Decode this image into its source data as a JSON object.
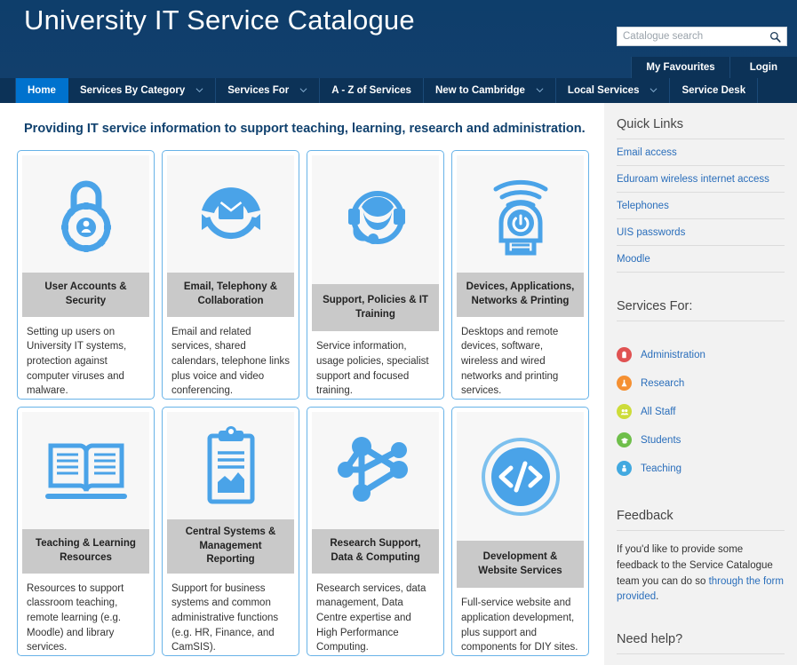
{
  "header": {
    "site_title": "University IT Service Catalogue",
    "search": {
      "placeholder": "Catalogue search",
      "value": "",
      "button_icon": "search-icon"
    },
    "account": {
      "favourites_label": "My Favourites",
      "login_label": "Login"
    },
    "colors": {
      "header_bg": "#10416e",
      "nav_bg": "#0c3257",
      "active_tab": "#0072ce"
    }
  },
  "nav": {
    "items": [
      {
        "label": "Home",
        "active": true,
        "caret": false
      },
      {
        "label": "Services By Category",
        "active": false,
        "caret": true
      },
      {
        "label": "Services For",
        "active": false,
        "caret": true
      },
      {
        "label": "A - Z of Services",
        "active": false,
        "caret": false
      },
      {
        "label": "New to Cambridge",
        "active": false,
        "caret": true
      },
      {
        "label": "Local Services",
        "active": false,
        "caret": true
      },
      {
        "label": "Service Desk",
        "active": false,
        "caret": false
      }
    ]
  },
  "main": {
    "intro": "Providing IT service information to support teaching, learning, research and administration.",
    "cards": [
      {
        "icon": "padlock-user-icon",
        "title": "User Accounts & Security",
        "desc": "Setting up users on University IT systems,  protection against computer viruses and malware."
      },
      {
        "icon": "email-collaboration-icon",
        "title": "Email, Telephony & Collaboration",
        "desc": "Email and related services, shared calendars, telephone links plus voice and video conferencing."
      },
      {
        "icon": "headset-support-icon",
        "title": "Support, Policies & IT Training",
        "desc": "Service information, usage policies, specialist support and focused training."
      },
      {
        "icon": "device-power-wireless-icon",
        "title": "Devices, Applications, Networks & Printing",
        "desc": "Desktops and remote devices, software, wireless and wired networks and printing services."
      },
      {
        "icon": "open-book-icon",
        "title": "Teaching & Learning Resources",
        "desc": "Resources to support classroom teaching, remote learning (e.g. Moodle) and library services."
      },
      {
        "icon": "clipboard-chart-icon",
        "title": "Central Systems & Management Reporting",
        "desc": "Support for business systems and common administrative functions (e.g. HR, Finance, and CamSIS)."
      },
      {
        "icon": "network-nodes-icon",
        "title": "Research Support, Data & Computing",
        "desc": "Research services, data management, Data Centre expertise and High Performance Computing."
      },
      {
        "icon": "code-brackets-icon",
        "title": "Development & Website Services",
        "desc": "Full-service website and application development, plus support and components for DIY sites."
      }
    ]
  },
  "sidebar": {
    "quick_links": {
      "heading": "Quick Links",
      "items": [
        {
          "label": "Email access"
        },
        {
          "label": "Eduroam wireless internet access"
        },
        {
          "label": "Telephones"
        },
        {
          "label": "UIS passwords"
        },
        {
          "label": "Moodle"
        }
      ]
    },
    "services_for": {
      "heading": "Services For:",
      "items": [
        {
          "label": "Administration",
          "color": "#e05252",
          "icon": "clipboard-icon"
        },
        {
          "label": "Research",
          "color": "#f59032",
          "icon": "flask-icon"
        },
        {
          "label": "All Staff",
          "color": "#cddc39",
          "icon": "people-icon"
        },
        {
          "label": "Students",
          "color": "#6fbf4b",
          "icon": "mortarboard-icon"
        },
        {
          "label": "Teaching",
          "color": "#42a9e0",
          "icon": "presenter-icon"
        }
      ]
    },
    "feedback": {
      "heading": "Feedback",
      "text_before": "If you'd like to provide some feedback to the Service Catalogue team you can do so ",
      "link_text": "through the form provided",
      "text_after": "."
    },
    "need_help": {
      "heading": "Need help?"
    }
  }
}
